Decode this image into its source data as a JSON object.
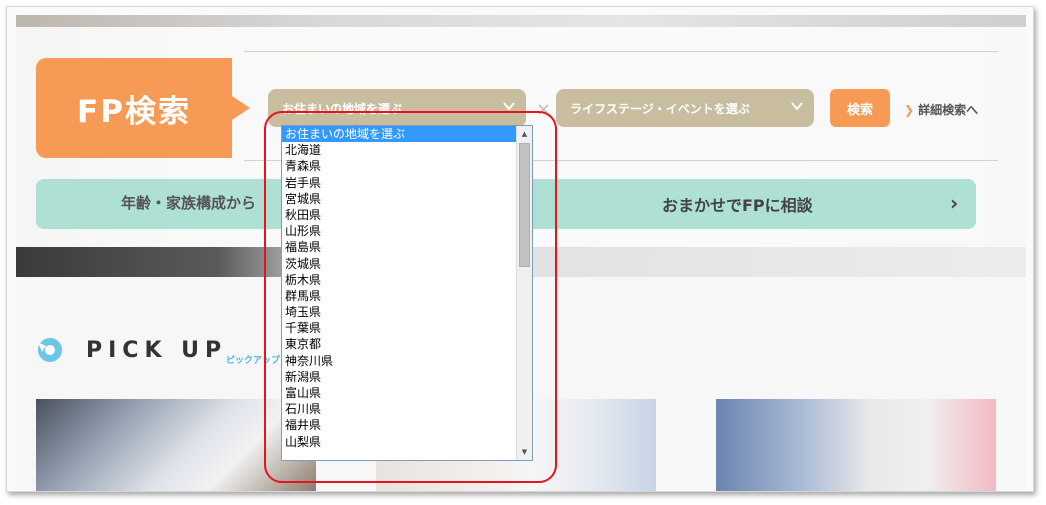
{
  "search": {
    "label": "FP検索",
    "region_select": "お住まいの地域を選ぶ",
    "life_select": "ライフステージ・イベントを選ぶ",
    "times": "×",
    "button": "検索",
    "detail_link": "詳細検索へ"
  },
  "consult": {
    "left": "年齢・家族構成から",
    "right": "おまかせでFPに相談"
  },
  "pickup": {
    "title": "PICK UP",
    "subtitle": "ピックアップ"
  },
  "dropdown": {
    "options": [
      "お住まいの地域を選ぶ",
      "北海道",
      "青森県",
      "岩手県",
      "宮城県",
      "秋田県",
      "山形県",
      "福島県",
      "茨城県",
      "栃木県",
      "群馬県",
      "埼玉県",
      "千葉県",
      "東京都",
      "神奈川県",
      "新潟県",
      "富山県",
      "石川県",
      "福井県",
      "山梨県"
    ],
    "selected_index": 0
  },
  "colors": {
    "orange": "#f79a55",
    "tan": "#c9bd9f",
    "mint": "#aee0d4",
    "highlight": "#e8141b"
  }
}
